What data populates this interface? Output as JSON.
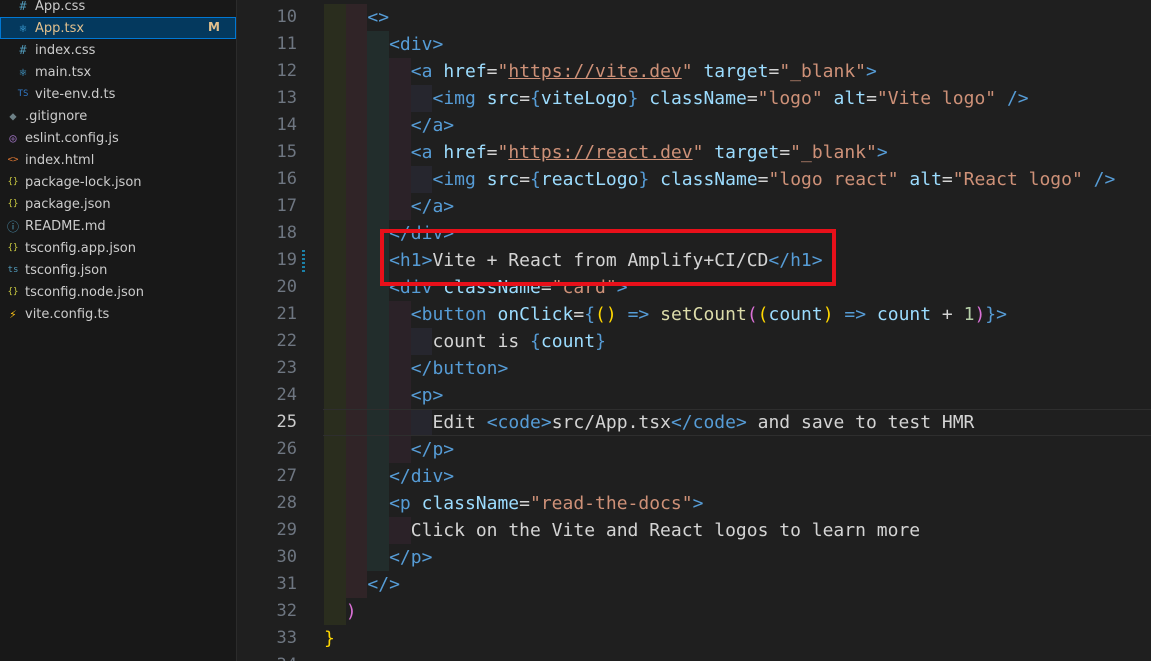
{
  "explorer": {
    "items": [
      {
        "name": "App.css",
        "icon": "#",
        "icon_color": "#519aba",
        "indent": 16,
        "selected": false,
        "badge": "",
        "name_color": "#cccccc"
      },
      {
        "name": "App.tsx",
        "icon": "⚛",
        "icon_color": "#4fc1ff",
        "indent": 16,
        "selected": true,
        "badge": "M",
        "name_color": "#e2c08d"
      },
      {
        "name": "index.css",
        "icon": "#",
        "icon_color": "#519aba",
        "indent": 16,
        "selected": false,
        "badge": "",
        "name_color": "#cccccc"
      },
      {
        "name": "main.tsx",
        "icon": "⚛",
        "icon_color": "#4fc1ff",
        "indent": 16,
        "selected": false,
        "badge": "",
        "name_color": "#cccccc"
      },
      {
        "name": "vite-env.d.ts",
        "icon": "TS",
        "icon_color": "#3178c6",
        "indent": 16,
        "selected": false,
        "badge": "",
        "name_color": "#cccccc"
      },
      {
        "name": ".gitignore",
        "icon": "◆",
        "icon_color": "#6d8086",
        "indent": 6,
        "selected": false,
        "badge": "",
        "name_color": "#cccccc"
      },
      {
        "name": "eslint.config.js",
        "icon": "◎",
        "icon_color": "#a074c4",
        "indent": 6,
        "selected": false,
        "badge": "",
        "name_color": "#cccccc"
      },
      {
        "name": "index.html",
        "icon": "<>",
        "icon_color": "#e37933",
        "indent": 6,
        "selected": false,
        "badge": "",
        "name_color": "#cccccc"
      },
      {
        "name": "package-lock.json",
        "icon": "{}",
        "icon_color": "#cbcb41",
        "indent": 6,
        "selected": false,
        "badge": "",
        "name_color": "#cccccc"
      },
      {
        "name": "package.json",
        "icon": "{}",
        "icon_color": "#cbcb41",
        "indent": 6,
        "selected": false,
        "badge": "",
        "name_color": "#cccccc"
      },
      {
        "name": "README.md",
        "icon": "ⓘ",
        "icon_color": "#519aba",
        "indent": 6,
        "selected": false,
        "badge": "",
        "name_color": "#cccccc"
      },
      {
        "name": "tsconfig.app.json",
        "icon": "{}",
        "icon_color": "#cbcb41",
        "indent": 6,
        "selected": false,
        "badge": "",
        "name_color": "#cccccc"
      },
      {
        "name": "tsconfig.json",
        "icon": "ts",
        "icon_color": "#519aba",
        "indent": 6,
        "selected": false,
        "badge": "",
        "name_color": "#cccccc"
      },
      {
        "name": "tsconfig.node.json",
        "icon": "{}",
        "icon_color": "#cbcb41",
        "indent": 6,
        "selected": false,
        "badge": "",
        "name_color": "#cccccc"
      },
      {
        "name": "vite.config.ts",
        "icon": "⚡",
        "icon_color": "#ffc517",
        "indent": 6,
        "selected": false,
        "badge": "",
        "name_color": "#cccccc"
      }
    ]
  },
  "editor": {
    "active_line": 25,
    "lines": [
      {
        "num": "10",
        "indent": 2,
        "tokens": [
          [
            "tag",
            "<>"
          ]
        ]
      },
      {
        "num": "11",
        "indent": 3,
        "tokens": [
          [
            "tag",
            "<div"
          ],
          [
            "tag",
            ">"
          ]
        ]
      },
      {
        "num": "12",
        "indent": 4,
        "tokens": [
          [
            "tag",
            "<a "
          ],
          [
            "attr",
            "href"
          ],
          [
            "text",
            "="
          ],
          [
            "str",
            "\""
          ],
          [
            "str-u",
            "https://vite.dev"
          ],
          [
            "str",
            "\""
          ],
          [
            "text",
            " "
          ],
          [
            "attr",
            "target"
          ],
          [
            "text",
            "="
          ],
          [
            "str",
            "\"_blank\""
          ],
          [
            "tag",
            ">"
          ]
        ]
      },
      {
        "num": "13",
        "indent": 5,
        "tokens": [
          [
            "tag",
            "<img "
          ],
          [
            "attr",
            "src"
          ],
          [
            "text",
            "="
          ],
          [
            "brace",
            "{"
          ],
          [
            "var",
            "viteLogo"
          ],
          [
            "brace",
            "}"
          ],
          [
            "text",
            " "
          ],
          [
            "attr",
            "className"
          ],
          [
            "text",
            "="
          ],
          [
            "str",
            "\"logo\""
          ],
          [
            "text",
            " "
          ],
          [
            "attr",
            "alt"
          ],
          [
            "text",
            "="
          ],
          [
            "str",
            "\"Vite logo\""
          ],
          [
            "text",
            " "
          ],
          [
            "tag",
            "/>"
          ]
        ]
      },
      {
        "num": "14",
        "indent": 4,
        "tokens": [
          [
            "tag",
            "</a>"
          ]
        ]
      },
      {
        "num": "15",
        "indent": 4,
        "tokens": [
          [
            "tag",
            "<a "
          ],
          [
            "attr",
            "href"
          ],
          [
            "text",
            "="
          ],
          [
            "str",
            "\""
          ],
          [
            "str-u",
            "https://react.dev"
          ],
          [
            "str",
            "\""
          ],
          [
            "text",
            " "
          ],
          [
            "attr",
            "target"
          ],
          [
            "text",
            "="
          ],
          [
            "str",
            "\"_blank\""
          ],
          [
            "tag",
            ">"
          ]
        ]
      },
      {
        "num": "16",
        "indent": 5,
        "tokens": [
          [
            "tag",
            "<img "
          ],
          [
            "attr",
            "src"
          ],
          [
            "text",
            "="
          ],
          [
            "brace",
            "{"
          ],
          [
            "var",
            "reactLogo"
          ],
          [
            "brace",
            "}"
          ],
          [
            "text",
            " "
          ],
          [
            "attr",
            "className"
          ],
          [
            "text",
            "="
          ],
          [
            "str",
            "\"logo react\""
          ],
          [
            "text",
            " "
          ],
          [
            "attr",
            "alt"
          ],
          [
            "text",
            "="
          ],
          [
            "str",
            "\"React logo\""
          ],
          [
            "text",
            " "
          ],
          [
            "tag",
            "/>"
          ]
        ]
      },
      {
        "num": "17",
        "indent": 4,
        "tokens": [
          [
            "tag",
            "</a>"
          ]
        ]
      },
      {
        "num": "18",
        "indent": 3,
        "tokens": [
          [
            "tag",
            "</div>"
          ]
        ]
      },
      {
        "num": "19",
        "indent": 3,
        "tokens": [
          [
            "tag",
            "<h1>"
          ],
          [
            "text",
            "Vite + React from Amplify+CI/CD"
          ],
          [
            "tag",
            "</h1>"
          ]
        ]
      },
      {
        "num": "20",
        "indent": 3,
        "tokens": [
          [
            "tag",
            "<div "
          ],
          [
            "attr",
            "className"
          ],
          [
            "text",
            "="
          ],
          [
            "str",
            "\"card\""
          ],
          [
            "tag",
            ">"
          ]
        ]
      },
      {
        "num": "21",
        "indent": 4,
        "tokens": [
          [
            "tag",
            "<button "
          ],
          [
            "attr",
            "onClick"
          ],
          [
            "text",
            "="
          ],
          [
            "brace",
            "{"
          ],
          [
            "gold",
            "("
          ],
          [
            "gold",
            ")"
          ],
          [
            "text",
            " "
          ],
          [
            "tag",
            "=>"
          ],
          [
            "text",
            " "
          ],
          [
            "fn",
            "setCount"
          ],
          [
            "purple",
            "("
          ],
          [
            "gold",
            "("
          ],
          [
            "var",
            "count"
          ],
          [
            "gold",
            ")"
          ],
          [
            "text",
            " "
          ],
          [
            "tag",
            "=>"
          ],
          [
            "text",
            " "
          ],
          [
            "var",
            "count"
          ],
          [
            "text",
            " + "
          ],
          [
            "num",
            "1"
          ],
          [
            "purple",
            ")"
          ],
          [
            "brace",
            "}"
          ],
          [
            "tag",
            ">"
          ]
        ]
      },
      {
        "num": "22",
        "indent": 5,
        "tokens": [
          [
            "text",
            "count is "
          ],
          [
            "brace",
            "{"
          ],
          [
            "var",
            "count"
          ],
          [
            "brace",
            "}"
          ]
        ]
      },
      {
        "num": "23",
        "indent": 4,
        "tokens": [
          [
            "tag",
            "</button>"
          ]
        ]
      },
      {
        "num": "24",
        "indent": 4,
        "tokens": [
          [
            "tag",
            "<p>"
          ]
        ]
      },
      {
        "num": "25",
        "indent": 5,
        "tokens": [
          [
            "text",
            "Edit "
          ],
          [
            "tag",
            "<code>"
          ],
          [
            "text",
            "src/App.tsx"
          ],
          [
            "tag",
            "</code>"
          ],
          [
            "text",
            " and save to test HMR"
          ]
        ]
      },
      {
        "num": "26",
        "indent": 4,
        "tokens": [
          [
            "tag",
            "</p>"
          ]
        ]
      },
      {
        "num": "27",
        "indent": 3,
        "tokens": [
          [
            "tag",
            "</div>"
          ]
        ]
      },
      {
        "num": "28",
        "indent": 3,
        "tokens": [
          [
            "tag",
            "<p "
          ],
          [
            "attr",
            "className"
          ],
          [
            "text",
            "="
          ],
          [
            "str",
            "\"read-the-docs\""
          ],
          [
            "tag",
            ">"
          ]
        ]
      },
      {
        "num": "29",
        "indent": 4,
        "tokens": [
          [
            "text",
            "Click on the Vite and React logos to learn more"
          ]
        ]
      },
      {
        "num": "30",
        "indent": 3,
        "tokens": [
          [
            "tag",
            "</p>"
          ]
        ]
      },
      {
        "num": "31",
        "indent": 2,
        "tokens": [
          [
            "tag",
            "</>"
          ]
        ]
      },
      {
        "num": "32",
        "indent": 1,
        "tokens": [
          [
            "purple",
            ")"
          ]
        ]
      },
      {
        "num": "33",
        "indent": 0,
        "tokens": [
          [
            "gold",
            "}"
          ]
        ]
      },
      {
        "num": "34",
        "indent": 0,
        "tokens": []
      }
    ]
  }
}
